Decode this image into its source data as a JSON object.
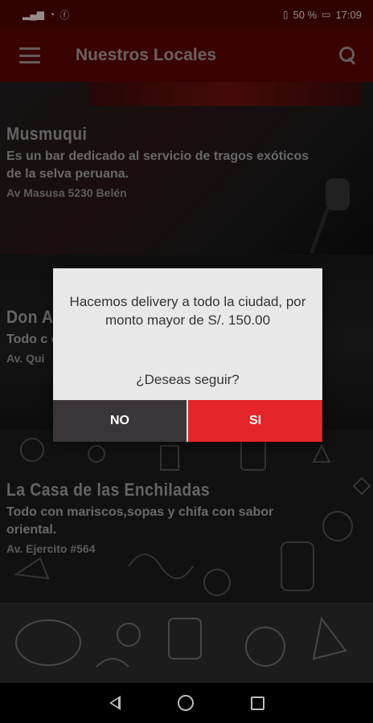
{
  "status_bar": {
    "battery": "50 %",
    "time": "17:09"
  },
  "app_bar": {
    "title": "Nuestros Locales"
  },
  "venues": [
    {
      "name": "Musmuqui",
      "description": "Es un bar dedicado al servicio de tragos exóticos de la selva peruana.",
      "address": "Av Masusa 5230 Belén"
    },
    {
      "name": "Don A",
      "description": "Todo c chifa c",
      "address": "Av. Qui"
    },
    {
      "name": "La Casa de las Enchiladas",
      "description": "Todo con mariscos,sopas y chifa con sabor oriental.",
      "address": "Av. Ejercito #564"
    }
  ],
  "dialog": {
    "message": "Hacemos delivery a todo la ciudad, por monto mayor de S/. 150.00",
    "question": "¿Deseas seguir?",
    "no_label": "NO",
    "si_label": "SI"
  }
}
